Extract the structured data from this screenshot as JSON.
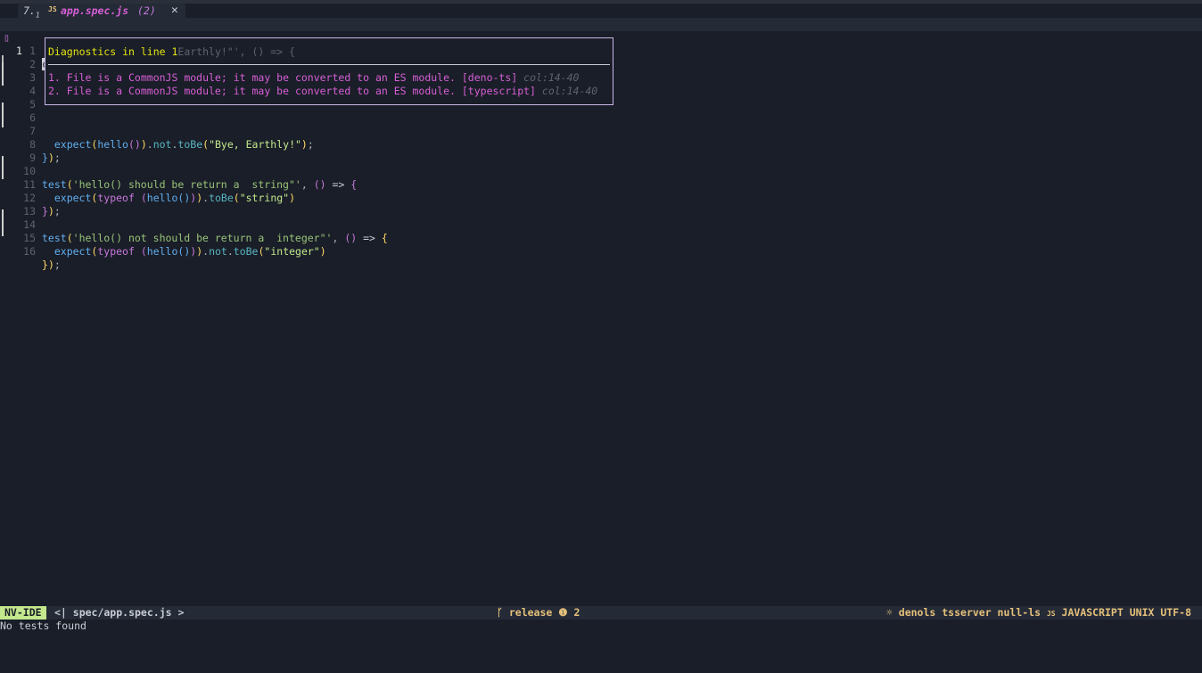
{
  "tab": {
    "index": "7.",
    "sub": "1",
    "file_icon": "JS",
    "title": "app.spec.js",
    "count": "(2)",
    "close": "✕"
  },
  "editor": {
    "line1": {
      "diag_sign": "",
      "number": "1",
      "end_sign": ""
    },
    "relative_numbers": [
      "1",
      "2",
      "3",
      "4",
      "5",
      "6",
      "7",
      "8",
      "9",
      "10",
      "11",
      "12",
      "13",
      "14",
      "15",
      "16"
    ]
  },
  "diagnostics_float": {
    "title": "Diagnostics in line 1",
    "ghost_text": "Earthly!\"', () => {",
    "items": [
      {
        "text": "1. File is a CommonJS module; it may be converted to an ES module. [deno-ts]",
        "col": "col:14-40"
      },
      {
        "text": "2. File is a CommonJS module; it may be converted to an ES module. [typescript]",
        "col": "col:14-40"
      }
    ]
  },
  "statusline": {
    "mode": "NV-IDE",
    "file": "<| spec/app.spec.js >",
    "branch": "release",
    "branch_count": "2",
    "branch_icon": "git-branch-icon",
    "lsp": "denols tsserver null-ls",
    "filetype": "JAVASCRIPT",
    "format": "UNIX",
    "encoding": "UTF-8"
  },
  "cmdline": {
    "message": "No tests found"
  }
}
